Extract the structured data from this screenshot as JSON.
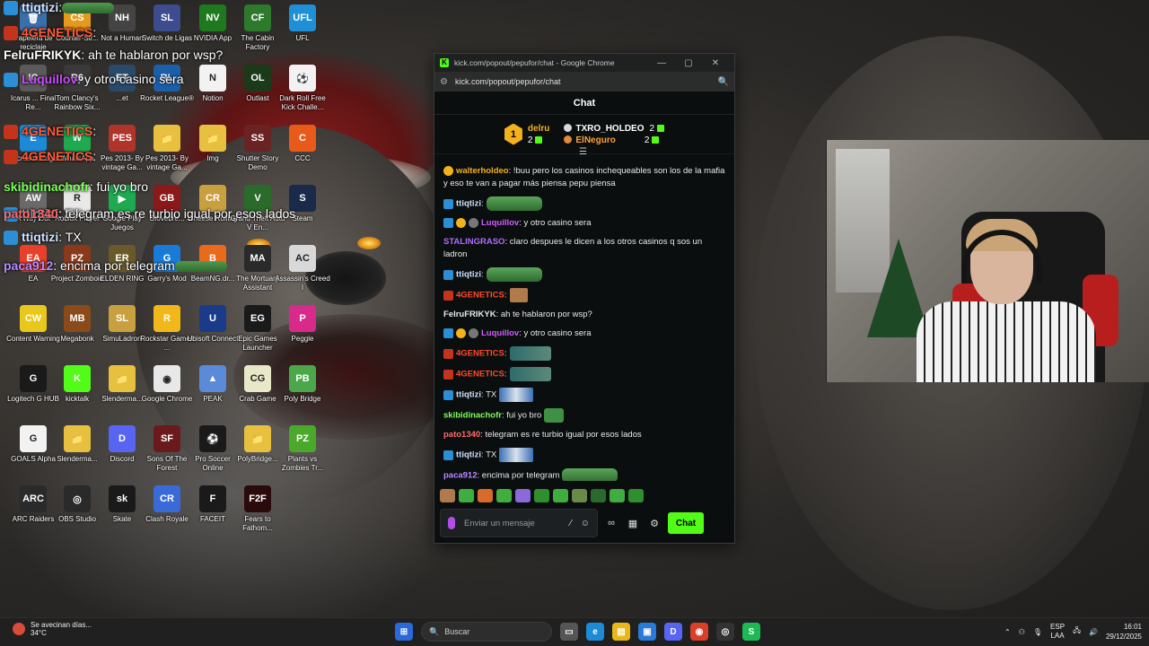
{
  "desktop": {
    "icons": [
      {
        "label": "Papelera de reciclaje",
        "color": "#3b6fa8",
        "glyph": "🗑"
      },
      {
        "label": "Counter-Str...",
        "color": "#e69a1c",
        "glyph": "CS"
      },
      {
        "label": "Not a Human",
        "color": "#444444",
        "glyph": "NH"
      },
      {
        "label": "Switch de Ligas",
        "color": "#3d4b8f",
        "glyph": "SL"
      },
      {
        "label": "NVIDIA App",
        "color": "#1f7a1f",
        "glyph": "NV"
      },
      {
        "label": "The Cabin Factory",
        "color": "#2d7a2d",
        "glyph": "CF"
      },
      {
        "label": "UFL",
        "color": "#1f8fd6",
        "glyph": "UFL"
      },
      {
        "label": "Icarus ... Final Re...",
        "color": "#5a5a5a",
        "glyph": "IC"
      },
      {
        "label": "Tom Clancy's Rainbow Six...",
        "color": "#3a3a3a",
        "glyph": "R6"
      },
      {
        "label": "...et",
        "color": "#2a4a6a",
        "glyph": "ET"
      },
      {
        "label": "Rocket League®",
        "color": "#1a5fa8",
        "glyph": "RL"
      },
      {
        "label": "Notion",
        "color": "#f2f2f2",
        "glyph": "N"
      },
      {
        "label": "Outlast",
        "color": "#1a3a1a",
        "glyph": "OL"
      },
      {
        "label": "Dark Roll Free Kick Challe...",
        "color": "#f2f2f2",
        "glyph": "⚽"
      },
      {
        "label": "Microsoft Edge",
        "color": "#1d8ad8",
        "glyph": "E"
      },
      {
        "label": "WhatsApp",
        "color": "#1faa4f",
        "glyph": "W"
      },
      {
        "label": "Pes 2013- By vintage Ga...",
        "color": "#b0342a",
        "glyph": "PES"
      },
      {
        "label": "Pes 2013- By vintage Ga...",
        "color": "#e8c040",
        "glyph": "📁"
      },
      {
        "label": "Img",
        "color": "#e8c040",
        "glyph": "📁"
      },
      {
        "label": "Shutter Story Demo",
        "color": "#6a2222",
        "glyph": "SS"
      },
      {
        "label": "CCC",
        "color": "#e85a1a",
        "glyph": "C"
      },
      {
        "label": "A Way Out",
        "color": "#6a6a6a",
        "glyph": "AW"
      },
      {
        "label": "Roblox Player",
        "color": "#e8e8e8",
        "glyph": "R"
      },
      {
        "label": "Google Play Juegos",
        "color": "#1faa4f",
        "glyph": "▶"
      },
      {
        "label": "Glovebre...",
        "color": "#8a1a1a",
        "glyph": "GB"
      },
      {
        "label": "Cheese Rolling",
        "color": "#c8a040",
        "glyph": "CR"
      },
      {
        "label": "Grand Theft Auto V En...",
        "color": "#2a6a2a",
        "glyph": "V"
      },
      {
        "label": "Steam",
        "color": "#1a2a4a",
        "glyph": "S"
      },
      {
        "label": "EA",
        "color": "#e8402a",
        "glyph": "EA"
      },
      {
        "label": "Project Zomboid",
        "color": "#8a3a1a",
        "glyph": "PZ"
      },
      {
        "label": "ELDEN RING",
        "color": "#6a5a2a",
        "glyph": "ER"
      },
      {
        "label": "Garry's Mod",
        "color": "#1a7ad8",
        "glyph": "G"
      },
      {
        "label": "BeamNG.dr...",
        "color": "#e86a1a",
        "glyph": "B"
      },
      {
        "label": "The Mortuary Assistant",
        "color": "#2a2a2a",
        "glyph": "MA"
      },
      {
        "label": "Assassin's Creed I",
        "color": "#d8d8d8",
        "glyph": "AC"
      },
      {
        "label": "Content Warning",
        "color": "#e8c81a",
        "glyph": "CW"
      },
      {
        "label": "Megabonk",
        "color": "#8a4a1a",
        "glyph": "MB"
      },
      {
        "label": "SimuLadron",
        "color": "#c8a040",
        "glyph": "SL"
      },
      {
        "label": "Rockstar Games ...",
        "color": "#f2b81a",
        "glyph": "R"
      },
      {
        "label": "Ubisoft Connect",
        "color": "#1a3a8a",
        "glyph": "U"
      },
      {
        "label": "Epic Games Launcher",
        "color": "#1a1a1a",
        "glyph": "EG"
      },
      {
        "label": "Peggle",
        "color": "#d82a8a",
        "glyph": "P"
      },
      {
        "label": "Logitech G HUB",
        "color": "#1a1a1a",
        "glyph": "G"
      },
      {
        "label": "kicktalk",
        "color": "#53fc18",
        "glyph": "K"
      },
      {
        "label": "Slenderma...",
        "color": "#e8c040",
        "glyph": "📁"
      },
      {
        "label": "Google Chrome",
        "color": "#e8e8e8",
        "glyph": "◉"
      },
      {
        "label": "PEAK",
        "color": "#5a8ad8",
        "glyph": "▲"
      },
      {
        "label": "Crab Game",
        "color": "#e8e8c8",
        "glyph": "CG"
      },
      {
        "label": "Poly Bridge",
        "color": "#4aa84a",
        "glyph": "PB"
      },
      {
        "label": "GOALS Alpha",
        "color": "#f2f2f2",
        "glyph": "G"
      },
      {
        "label": "Slenderma...",
        "color": "#e8c040",
        "glyph": "📁"
      },
      {
        "label": "Discord",
        "color": "#5865f2",
        "glyph": "D"
      },
      {
        "label": "Sons Of The Forest",
        "color": "#6a1a1a",
        "glyph": "SF"
      },
      {
        "label": "Pro Soccer Online",
        "color": "#1a1a1a",
        "glyph": "⚽"
      },
      {
        "label": "PolyBridge...",
        "color": "#e8c040",
        "glyph": "📁"
      },
      {
        "label": "Plants vs Zombies Tr...",
        "color": "#4aa82a",
        "glyph": "PZ"
      },
      {
        "label": "ARC Raiders",
        "color": "#2a2a2a",
        "glyph": "ARC"
      },
      {
        "label": "OBS Studio",
        "color": "#2a2a2a",
        "glyph": "◎"
      },
      {
        "label": "Skate",
        "color": "#1a1a1a",
        "glyph": "sk"
      },
      {
        "label": "Clash Royale",
        "color": "#3a6ad8",
        "glyph": "CR"
      },
      {
        "label": "FACEIT",
        "color": "#1a1a1a",
        "glyph": "F"
      },
      {
        "label": "Fears to Fathom...",
        "color": "#2a0a0a",
        "glyph": "F2F"
      }
    ],
    "overlay_chat": [
      {
        "user": "ttiqtizi",
        "text": ":",
        "user_color": "#cfe3ff",
        "badge": "blue",
        "emote": "pepe"
      },
      {
        "user": "4GENETICS",
        "text": ":",
        "user_color": "#ff5a3a",
        "badge": "red",
        "emote": ""
      },
      {
        "user": "FelruFRIKYK",
        "text": ": ah te hablaron por wsp?",
        "user_color": "#ffffff",
        "badge": "",
        "emote": ""
      },
      {
        "user": "Luquillov",
        "text": ": y otro casino sera",
        "user_color": "#c94bff",
        "badge": "blue",
        "emote": ""
      },
      {
        "user": "4GENETICS",
        "text": ":",
        "user_color": "#ff5a3a",
        "badge": "red",
        "emote": ""
      },
      {
        "user": "4GENETICS",
        "text": ":",
        "user_color": "#ff5a3a",
        "badge": "red",
        "emote": ""
      },
      {
        "user": "ttiqtizi",
        "text": ": TX",
        "user_color": "#cfe3ff",
        "badge": "blue",
        "emote": ""
      },
      {
        "user": "skibidinachofr",
        "text": ": fui yo bro",
        "user_color": "#7dff5a",
        "badge": "",
        "emote": ""
      },
      {
        "user": "pato1340",
        "text": ": telegram es re turbio igual por esos lados",
        "user_color": "#ff6a6a",
        "badge": "",
        "emote": ""
      },
      {
        "user": "ttiqtizi",
        "text": ": TX",
        "user_color": "#cfe3ff",
        "badge": "blue",
        "emote": ""
      },
      {
        "user": "paca912",
        "text": ": encima por telegram",
        "user_color": "#b78bff",
        "badge": "",
        "emote": "pepe"
      }
    ]
  },
  "window": {
    "title": "kick.com/popout/pepufor/chat - Google Chrome",
    "url": "kick.com/popout/pepufor/chat",
    "minimize": "—",
    "maximize": "▢",
    "close": "✕"
  },
  "chat": {
    "header": "Chat",
    "leaderboard": {
      "rank1": {
        "rank": "1",
        "name": "delru",
        "count": "2"
      },
      "rank2": {
        "name": "TXRO_HOLDEO",
        "count": "2"
      },
      "rank3": {
        "name": "ElNeguro",
        "count": "2"
      }
    },
    "messages": [
      {
        "user": "walterholdeo",
        "text": ": !buu pero los casinos inchequeables son los de la mafia y eso te van a pagar más piensa pepu piensa",
        "user_color": "#f3b21b",
        "badges": [
          "gold"
        ],
        "emote": ""
      },
      {
        "user": "ttiqtizi",
        "text": ":",
        "user_color": "#cfe3ff",
        "badges": [
          "blue"
        ],
        "emote": "pepe"
      },
      {
        "user": "Luquillov",
        "text": ": y otro casino sera",
        "user_color": "#d35bff",
        "badges": [
          "blue",
          "gold",
          "gray"
        ],
        "emote": ""
      },
      {
        "user": "STALINGRASO",
        "text": ": claro despues le dicen a los otros casinos q sos un ladron",
        "user_color": "#b06bff",
        "badges": [],
        "emote": ""
      },
      {
        "user": "ttiqtizi",
        "text": ":",
        "user_color": "#cfe3ff",
        "badges": [
          "blue"
        ],
        "emote": "pepe"
      },
      {
        "user": "4GENETICS",
        "text": ":",
        "user_color": "#ff4a2a",
        "badges": [
          "red"
        ],
        "emote": "face"
      },
      {
        "user": "FelruFRIKYK",
        "text": ": ah te hablaron por wsp?",
        "user_color": "#e8e8e8",
        "badges": [],
        "emote": ""
      },
      {
        "user": "Luquillov",
        "text": ": y otro casino sera",
        "user_color": "#d35bff",
        "badges": [
          "blue",
          "gold",
          "gray"
        ],
        "emote": ""
      },
      {
        "user": "4GENETICS",
        "text": ":",
        "user_color": "#ff4a2a",
        "badges": [
          "red"
        ],
        "emote": "ghost"
      },
      {
        "user": "4GENETICS",
        "text": ":",
        "user_color": "#ff4a2a",
        "badges": [
          "red"
        ],
        "emote": "ghost"
      },
      {
        "user": "ttiqtizi",
        "text": ": TX",
        "user_color": "#cfe3ff",
        "badges": [
          "blue"
        ],
        "emote": "tx"
      },
      {
        "user": "skibidinachofr",
        "text": ": fui yo bro",
        "user_color": "#7dff5a",
        "badges": [],
        "emote": "frog"
      },
      {
        "user": "pato1340",
        "text": ": telegram es re turbio igual por esos lados",
        "user_color": "#ff6a6a",
        "badges": [],
        "emote": ""
      },
      {
        "user": "ttiqtizi",
        "text": ": TX",
        "user_color": "#cfe3ff",
        "badges": [
          "blue"
        ],
        "emote": "tx"
      },
      {
        "user": "paca912",
        "text": ": encima por telegram",
        "user_color": "#b78bff",
        "badges": [],
        "emote": "pepe"
      }
    ],
    "emote_bar_colors": [
      "#b07a4a",
      "#3fae3f",
      "#d86a2a",
      "#3fae3f",
      "#8a6ad8",
      "#2f8f2f",
      "#3fae3f",
      "#6a8a4a",
      "#2a6a2a",
      "#3fae3f",
      "#2f8f2f"
    ],
    "input_placeholder": "Enviar un mensaje",
    "send_label": "Chat"
  },
  "taskbar": {
    "weather_title": "Se avecinan días...",
    "weather_temp": "34°C",
    "weather_alert": "1",
    "search_placeholder": "Buscar",
    "lang_1": "ESP",
    "lang_2": "LAA",
    "time": "16:01",
    "date": "29/12/2025"
  }
}
